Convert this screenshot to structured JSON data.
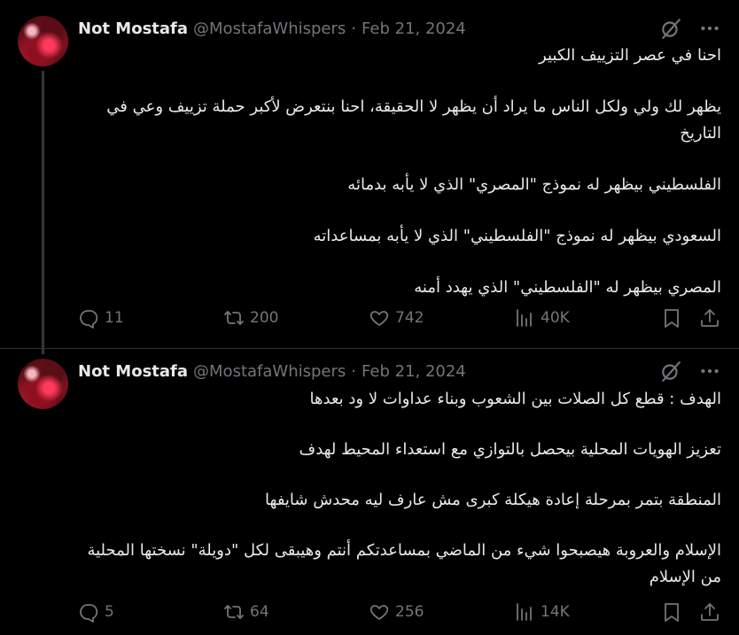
{
  "tweets": [
    {
      "name": "Not Mostafa",
      "handle": "@MostafaWhispers",
      "separator": "·",
      "date": "Feb 21, 2024",
      "paragraphs": [
        "احنا في عصر التزييف الكبير",
        "يظهر لك ولي ولكل الناس ما يراد أن يظهر لا الحقيقة، احنا بنتعرض لأكبر حملة تزييف وعي في التاريخ",
        "الفلسطيني بيظهر له نموذج \"المصري\" الذي لا يأبه بدمائه",
        "السعودي بيظهر له نموذج \"الفلسطيني\" الذي لا يأبه بمساعداته",
        "المصري بيظهر له \"الفلسطيني\" الذي يهدد أمنه"
      ],
      "replies": "11",
      "reposts": "200",
      "likes": "742",
      "views": "40K"
    },
    {
      "name": "Not Mostafa",
      "handle": "@MostafaWhispers",
      "separator": "·",
      "date": "Feb 21, 2024",
      "paragraphs": [
        "الهدف : قطع كل الصلات بين الشعوب وبناء عداوات لا ود بعدها",
        "تعزيز الهويات المحلية بيحصل بالتوازي مع استعداء المحيط لهدف",
        "المنطقة بتمر بمرحلة إعادة هيكلة كبرى مش عارف ليه محدش شايفها",
        "الإسلام والعروبة هيصبحوا شيء من الماضي بمساعدتكم أنتم وهيبقى لكل \"دويلة\" نسختها المحلية من الإسلام"
      ],
      "replies": "5",
      "reposts": "64",
      "likes": "256",
      "views": "14K"
    }
  ],
  "icons": {
    "grok": "grok-icon",
    "more": "more-icon",
    "reply": "reply-icon",
    "repost": "repost-icon",
    "like": "heart-icon",
    "views": "views-icon",
    "bookmark": "bookmark-icon",
    "share": "share-icon"
  },
  "colors": {
    "background": "#000000",
    "text": "#e7e9ea",
    "muted": "#71767b",
    "line": "#333639"
  }
}
